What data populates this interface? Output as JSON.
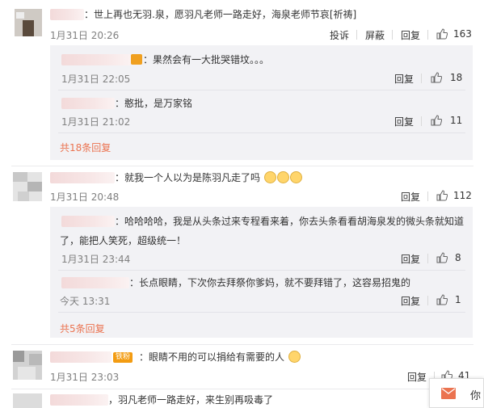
{
  "comments": [
    {
      "text": "：世上再也无羽.泉，愿羽凡老师一路走好，海泉老师节哀[祈祷]",
      "time": "1月31日 20:26",
      "report": "投诉",
      "block": "屏蔽",
      "reply": "回复",
      "likes": "163",
      "replies": [
        {
          "text": "：果然会有一大批哭错坟。。。",
          "time": "1月31日 22:05",
          "reply": "回复",
          "likes": "18"
        },
        {
          "text": "：憨批，是万家铭",
          "time": "1月31日 21:02",
          "reply": "回复",
          "likes": "11"
        }
      ],
      "more": "共18条回复"
    },
    {
      "text": "：就我一个人以为是陈羽凡走了吗",
      "time": "1月31日 20:48",
      "reply": "回复",
      "likes": "112",
      "replies": [
        {
          "text_line1": "：哈哈哈哈，我是从头条过来专程看来着，你去头条看看胡海泉发的微头条就知道",
          "text_line2": "了，能把人笑死，超级统一！",
          "time": "1月31日 23:44",
          "reply": "回复",
          "likes": "8"
        },
        {
          "text": "：长点眼睛，下次你去拜祭你爹妈，就不要拜错了，这容易招鬼的",
          "time": "今天 13:31",
          "reply": "回复",
          "likes": "1"
        }
      ],
      "more": "共5条回复"
    },
    {
      "badge": "铁粉",
      "text": "：眼睛不用的可以捐给有需要的人",
      "time": "1月31日 23:03",
      "reply": "回复",
      "likes": "41"
    },
    {
      "text": "，羽凡老师一路走好，来生别再吸毒了"
    }
  ],
  "toast": {
    "label": "你"
  },
  "colors": {
    "accent": "#eb7350",
    "badge": "#f39c12",
    "reply_bg": "#f2f2f5"
  }
}
